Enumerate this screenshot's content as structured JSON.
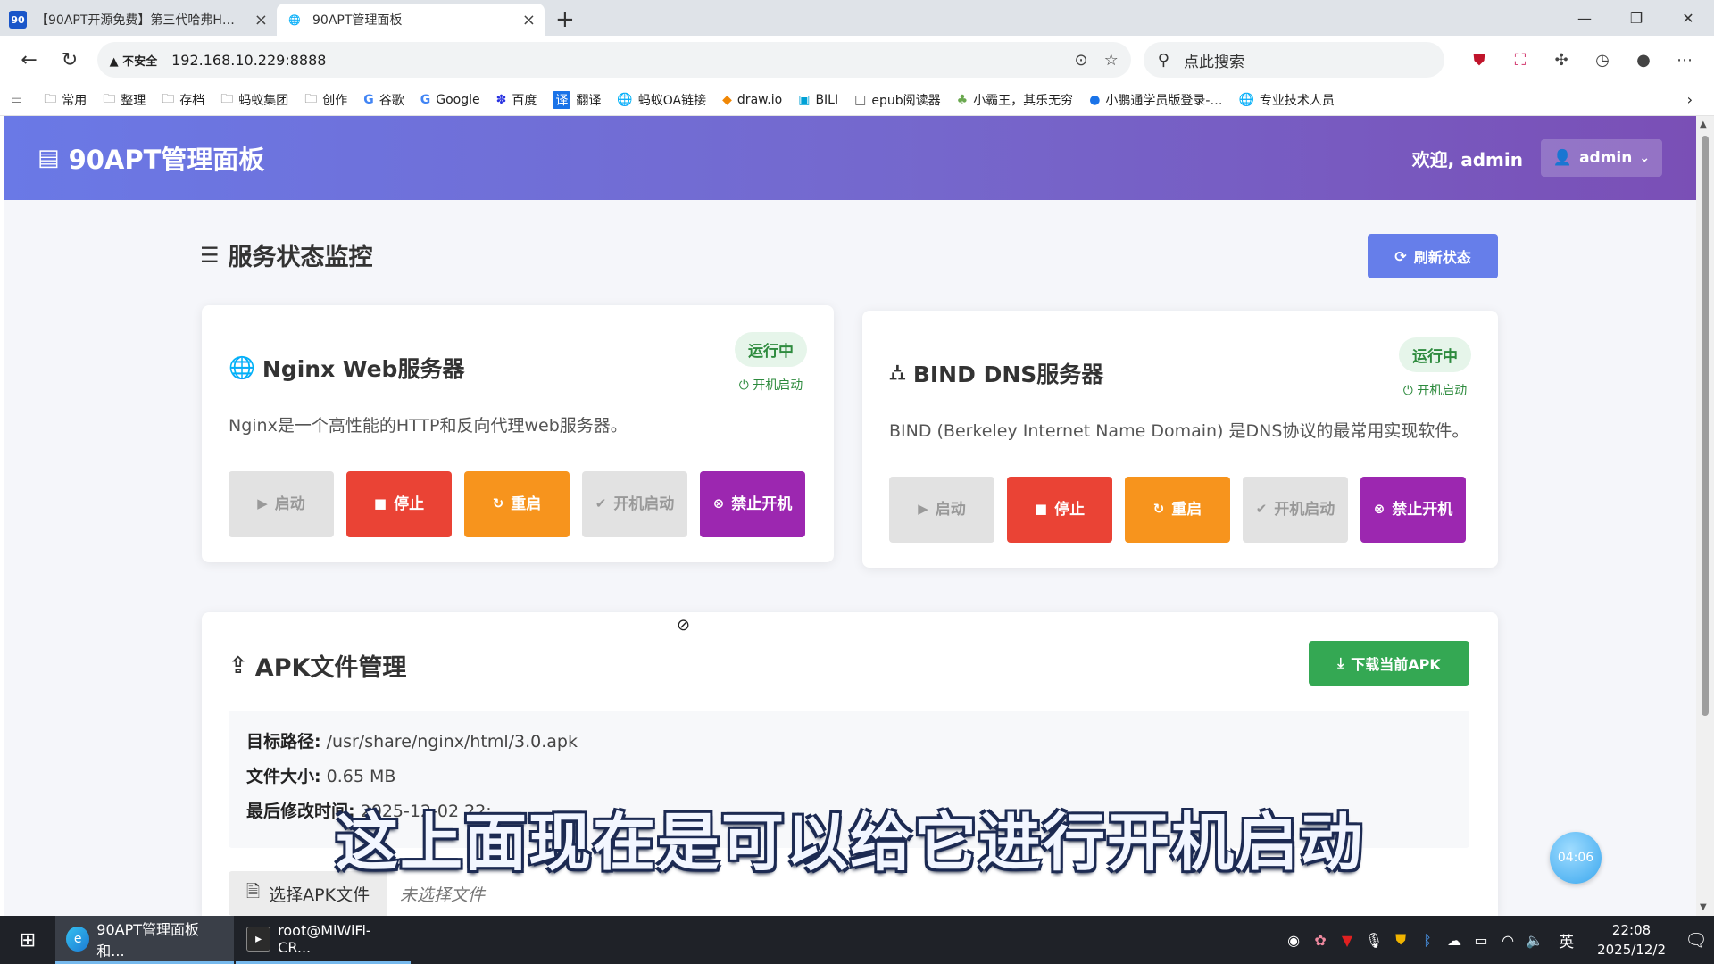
{
  "browser": {
    "tabs": [
      {
        "title": "【90APT开源免费】第三代哈弗H…",
        "favicon": "90",
        "active": false
      },
      {
        "title": "90APT管理面板",
        "favicon": "globe-icon",
        "active": true
      }
    ],
    "security_label": "不安全",
    "url": "192.168.10.229:8888",
    "search_placeholder": "点此搜索",
    "bookmarks": [
      "常用",
      "整理",
      "存档",
      "蚂蚁集团",
      "创作",
      "谷歌",
      "Google",
      "百度",
      "翻译",
      "蚂蚁OA链接",
      "draw.io",
      "BILI",
      "epub阅读器",
      "小霸王，其乐无穷",
      "小鹏通学员版登录-…",
      "专业技术人员"
    ]
  },
  "app": {
    "brand": "90APT管理面板",
    "welcome": "欢迎, admin",
    "user_menu": "admin"
  },
  "services": {
    "title": "服务状态监控",
    "refresh_label": "刷新状态",
    "nginx": {
      "name": "Nginx Web服务器",
      "status": "运行中",
      "boot": "开机启动",
      "description": "Nginx是一个高性能的HTTP和反向代理web服务器。"
    },
    "bind": {
      "name": "BIND DNS服务器",
      "status": "运行中",
      "boot": "开机启动",
      "description": "BIND (Berkeley Internet Name Domain) 是DNS协议的最常用实现软件。"
    },
    "actions": {
      "start": "启动",
      "stop": "停止",
      "restart": "重启",
      "enable_boot": "开机启动",
      "disable_boot": "禁止开机"
    }
  },
  "apk": {
    "title": "APK文件管理",
    "download_label": "下载当前APK",
    "path_label": "目标路径:",
    "path_value": "/usr/share/nginx/html/3.0.apk",
    "size_label": "文件大小:",
    "size_value": "0.65 MB",
    "modified_label": "最后修改时间:",
    "modified_value": "2025-12-02 22:…",
    "choose_label": "选择APK文件",
    "no_file": "未选择文件"
  },
  "overlay": {
    "subtitle": "这上面现在是可以给它进行开机启动",
    "timer": "04:06"
  },
  "taskbar": {
    "tasks": [
      "90APT管理面板 和...",
      "root@MiWiFi-CR..."
    ],
    "ime": "英",
    "time": "22:08",
    "date": "2025/12/2"
  },
  "colors": {
    "header_start": "#6a79e6",
    "header_end": "#7a4fb6",
    "refresh": "#667eea",
    "stop": "#ea4335",
    "restart": "#f7941d",
    "disable_boot": "#9c27b0",
    "download": "#34a853",
    "status_green": "#2e8b3e"
  }
}
